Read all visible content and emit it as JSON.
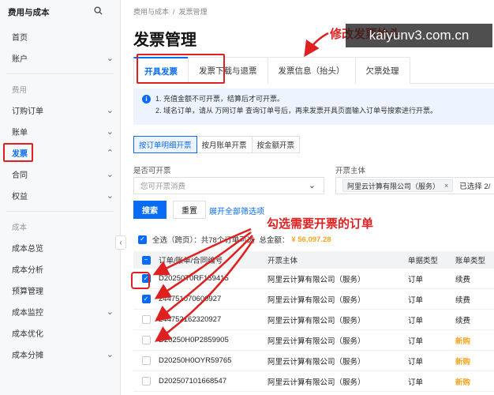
{
  "sidebar": {
    "title": "费用与成本",
    "items_top": [
      {
        "label": "首页",
        "has_chevron": false
      },
      {
        "label": "账户",
        "has_chevron": true
      }
    ],
    "section_cost": "费用",
    "items_fee": [
      {
        "label": "订购订单",
        "has_chevron": true
      },
      {
        "label": "账单",
        "has_chevron": true
      },
      {
        "label": "发票",
        "has_chevron": true,
        "active": true
      },
      {
        "label": "合同",
        "has_chevron": true
      },
      {
        "label": "权益",
        "has_chevron": true
      }
    ],
    "section_cost2": "成本",
    "items_cost": [
      {
        "label": "成本总览",
        "has_chevron": false
      },
      {
        "label": "成本分析",
        "has_chevron": false
      },
      {
        "label": "预算管理",
        "has_chevron": false
      },
      {
        "label": "成本监控",
        "has_chevron": true
      },
      {
        "label": "成本优化",
        "has_chevron": false
      },
      {
        "label": "成本分摊",
        "has_chevron": true
      }
    ]
  },
  "breadcrumb": [
    "费用与成本",
    "发票管理"
  ],
  "page_title": "发票管理",
  "tabs": [
    {
      "label": "开具发票",
      "active": true
    },
    {
      "label": "发票下载与退票",
      "active": false
    },
    {
      "label": "发票信息（抬头）",
      "active": false
    },
    {
      "label": "欠票处理",
      "active": false
    }
  ],
  "notice": {
    "line1": "1. 充值金额不可开票，结算后才可开票。",
    "line2": "2. 域名订单，请从 万网订单 查询订单号后，再来发票开具页面输入订单号搜索进行开票。"
  },
  "subtabs": [
    {
      "label": "按订单明细开票",
      "active": true
    },
    {
      "label": "按月账单开票",
      "active": false
    },
    {
      "label": "按金额开票",
      "active": false
    }
  ],
  "filters": {
    "invoiceable_label": "是否可开票",
    "invoiceable_placeholder": "您可开票消费",
    "entity_label": "开票主体",
    "entity_tag": "阿里云计算有限公司（服务）",
    "entity_tag_close": "×",
    "entity_selected": "已选择 2/"
  },
  "buttons": {
    "search": "搜索",
    "reset": "重置",
    "expand": "展开全部筛选项"
  },
  "select_all": {
    "text": "全选（跨页）：共78个订单可选",
    "amount_label": "总金额：",
    "amount": "¥ 56,097.28"
  },
  "table": {
    "headers": [
      "订单/账单/合同编号",
      "开票主体",
      "单据类型",
      "账单类型"
    ],
    "rows": [
      {
        "checked": true,
        "id": "D20250T0RF159415",
        "entity": "阿里云计算有限公司（服务）",
        "doc_type": "订单",
        "bill_type": "续费",
        "new": false
      },
      {
        "checked": true,
        "id": "244751070600927",
        "entity": "阿里云计算有限公司（服务）",
        "doc_type": "订单",
        "bill_type": "续费",
        "new": false
      },
      {
        "checked": false,
        "id": "244752162320927",
        "entity": "阿里云计算有限公司（服务）",
        "doc_type": "订单",
        "bill_type": "续费",
        "new": false
      },
      {
        "checked": false,
        "id": "D20250H0P2859905",
        "entity": "阿里云计算有限公司（服务）",
        "doc_type": "订单",
        "bill_type": "新购",
        "new": true
      },
      {
        "checked": false,
        "id": "D20250H0OYR59765",
        "entity": "阿里云计算有限公司（服务）",
        "doc_type": "订单",
        "bill_type": "新购",
        "new": true
      },
      {
        "checked": false,
        "id": "D202507101668547",
        "entity": "阿里云计算有限公司（服务）",
        "doc_type": "订单",
        "bill_type": "新购",
        "new": true
      }
    ]
  },
  "annotations": {
    "modify_header": "修改发票抬头",
    "select_orders": "勾选需要开票的订单",
    "watermark_url": "kaiyunv3.com.cn"
  },
  "colors": {
    "primary": "#0a6cf5",
    "annotation": "#e02020",
    "amount": "#f5a623"
  }
}
